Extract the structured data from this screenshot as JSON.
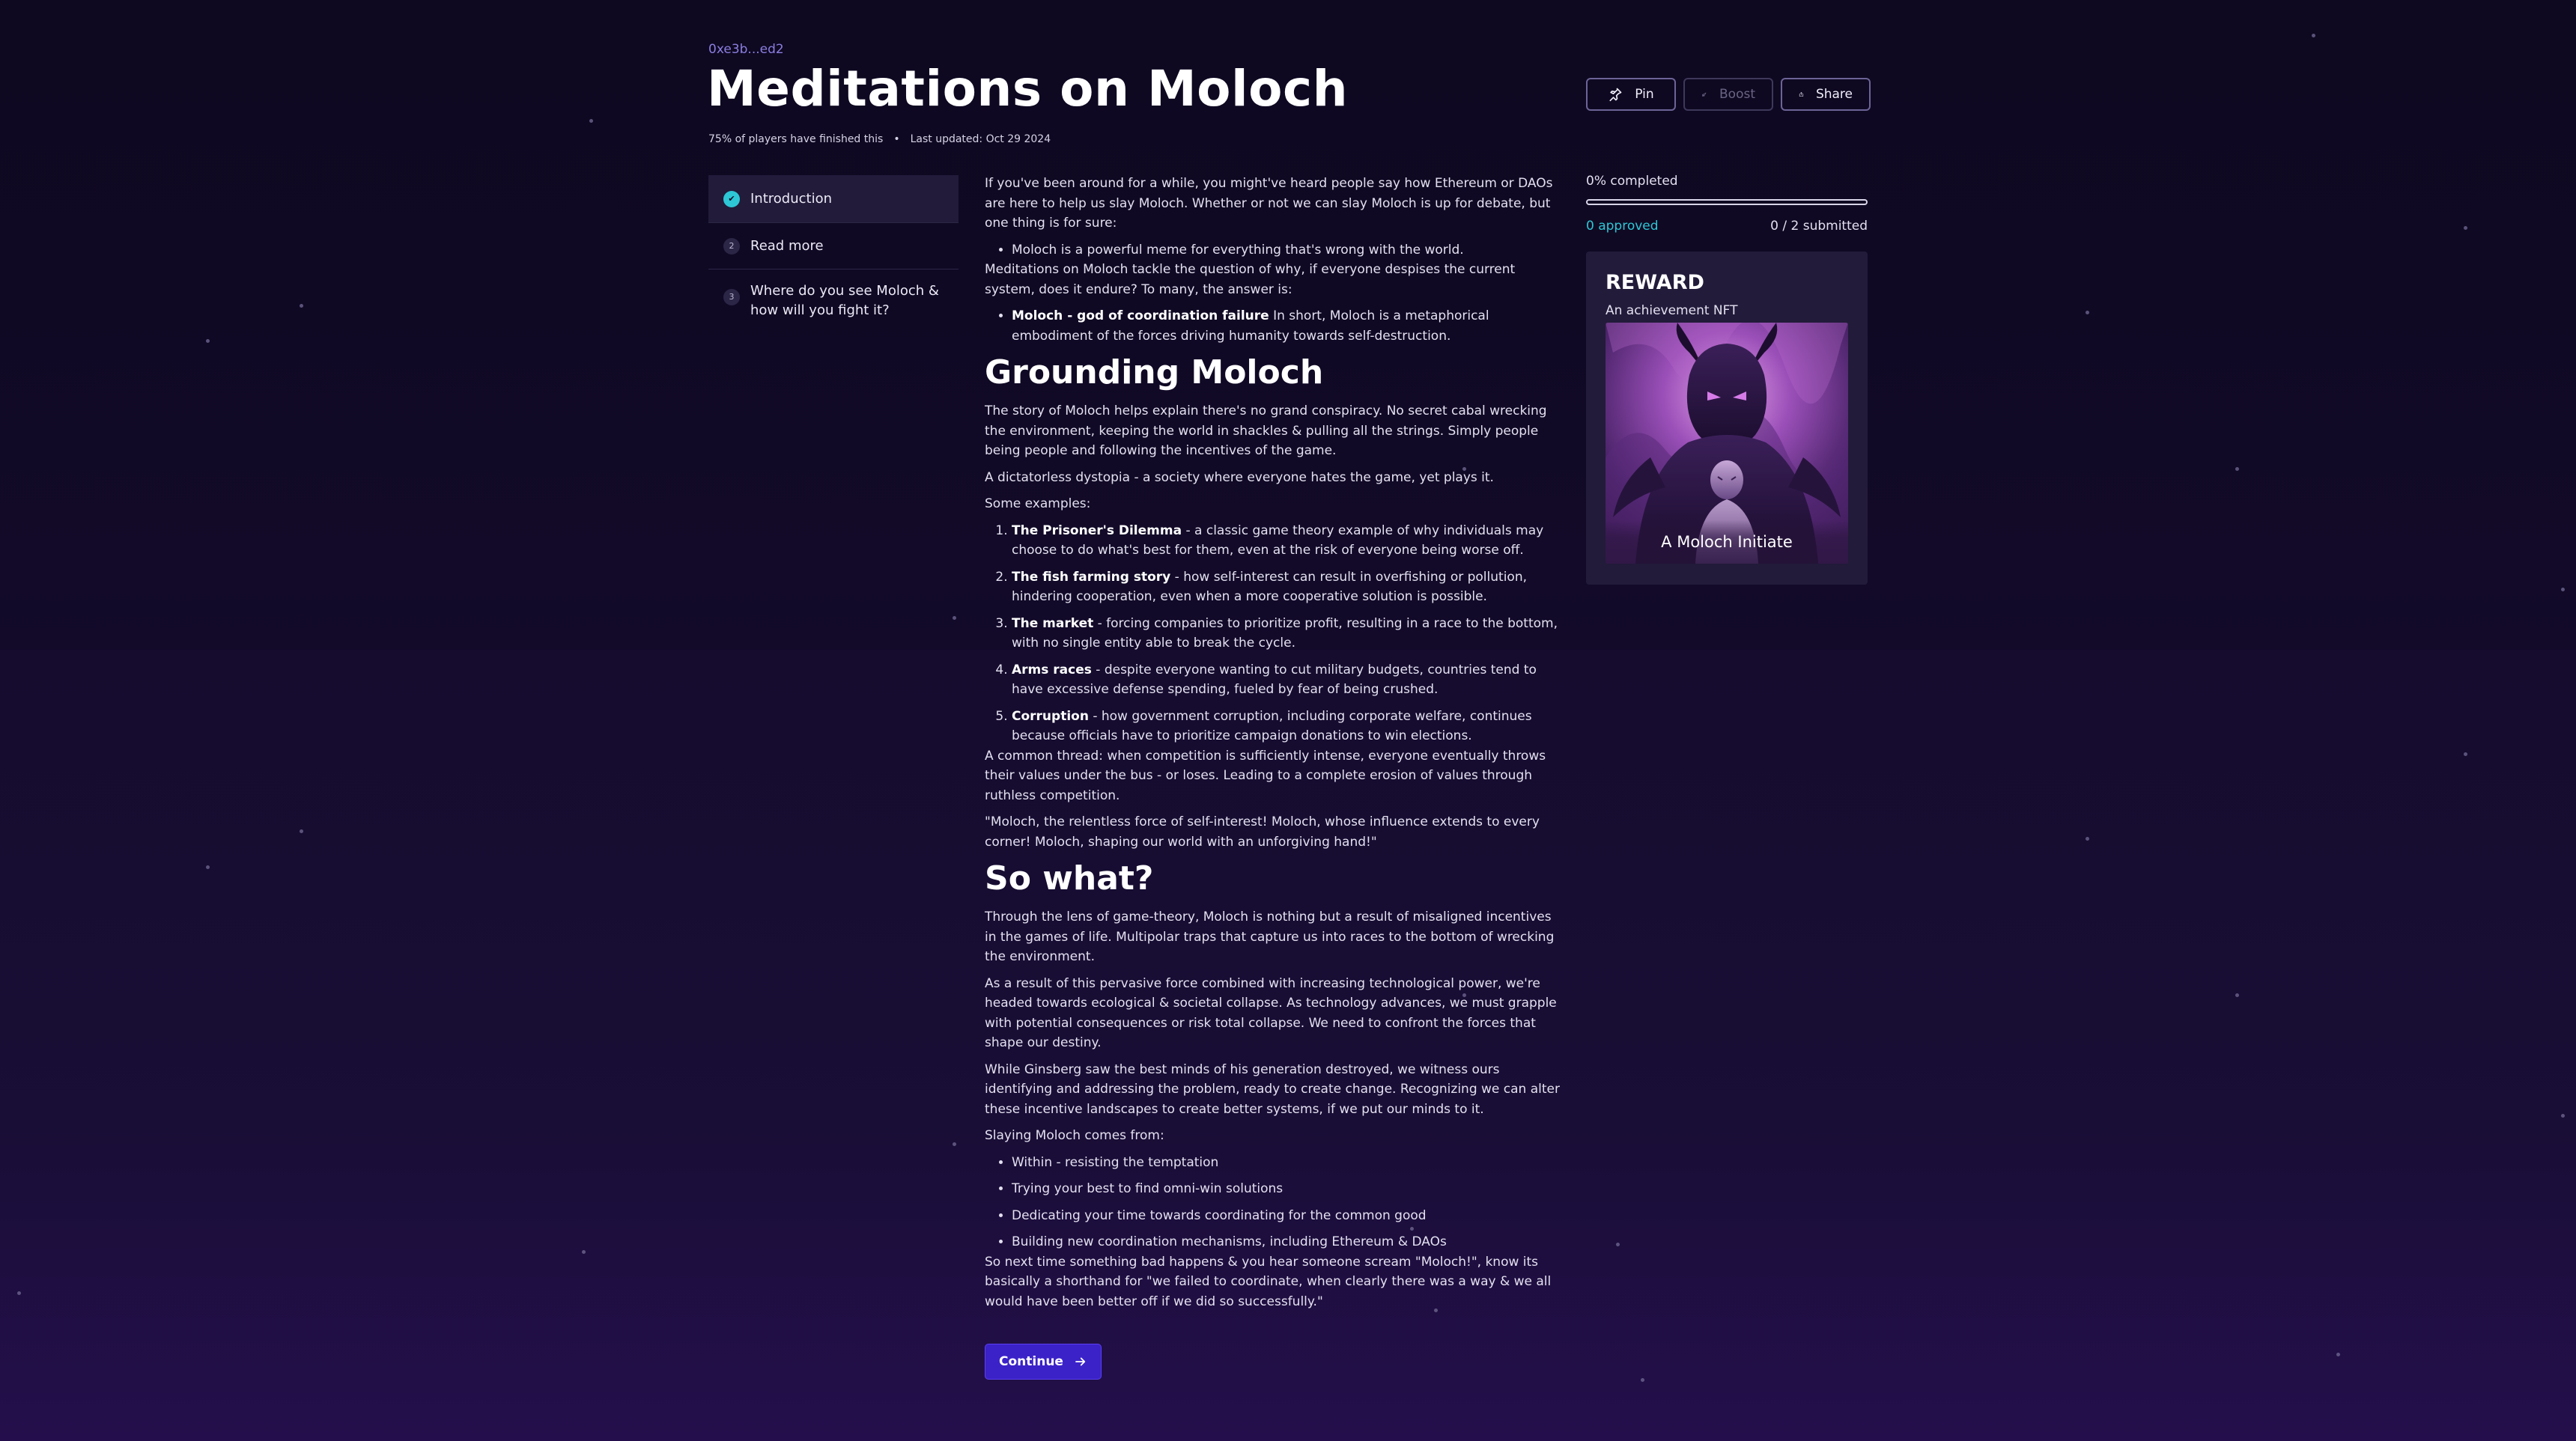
{
  "header": {
    "address": "0xe3b...ed2",
    "title": "Meditations on Moloch",
    "completion_stat": "75% of players have finished this",
    "separator": "•",
    "last_updated": "Last updated: Oct 29 2024"
  },
  "actions": {
    "pin_label": "Pin",
    "boost_label": "Boost",
    "share_label": "Share"
  },
  "toc": {
    "items": [
      {
        "number": "1",
        "label": "Introduction",
        "state": "done"
      },
      {
        "number": "2",
        "label": "Read more",
        "state": "pending"
      },
      {
        "number": "3",
        "label": "Where do you see Moloch & how will you fight it?",
        "state": "pending"
      }
    ]
  },
  "article": {
    "intro_p1": "If you've been around for a while, you might've heard people say how Ethereum or DAOs are here to help us slay Moloch. Whether or not we can slay Moloch is up for debate, but one thing is for sure:",
    "intro_bullet": "Moloch is a powerful meme for everything that's wrong with the world.",
    "intro_p2": "Meditations on Moloch tackle the question of why, if everyone despises the current system, does it endure? To many, the answer is:",
    "def_bold": "Moloch - god of coordination failure",
    "def_text": " In short, Moloch is a metaphorical embodiment of the forces driving humanity towards self-destruction.",
    "h_grounding": "Grounding Moloch",
    "grounding_p1": "The story of Moloch helps explain there's no grand conspiracy. No secret cabal wrecking the environment, keeping the world in shackles & pulling all the strings. Simply people being people and following the incentives of the game.",
    "grounding_p2": "A dictatorless dystopia - a society where everyone hates the game, yet plays it.",
    "examples_intro": "Some examples:",
    "examples": [
      {
        "bold": "The Prisoner's Dilemma",
        "text": " - a classic game theory example of why individuals may choose to do what's best for them, even at the risk of everyone being worse off."
      },
      {
        "bold": "The fish farming story",
        "text": " - how self-interest can result in overfishing or pollution, hindering cooperation, even when a more cooperative solution is possible."
      },
      {
        "bold": "The market",
        "text": " - forcing companies to prioritize profit, resulting in a race to the bottom, with no single entity able to break the cycle."
      },
      {
        "bold": "Arms races",
        "text": " - despite everyone wanting to cut military budgets, countries tend to have excessive defense spending, fueled by fear of being crushed."
      },
      {
        "bold": "Corruption",
        "text": " - how government corruption, including corporate welfare, continues because officials have to prioritize campaign donations to win elections."
      }
    ],
    "thread_p": "A common thread: when competition is sufficiently intense, everyone eventually throws their values under the bus - or loses. Leading to a complete erosion of values through ruthless competition.",
    "quote_p": "\"Moloch, the relentless force of self-interest! Moloch, whose influence extends to every corner! Moloch, shaping our world with an unforgiving hand!\"",
    "h_sowhat": "So what?",
    "sowhat_p1": "Through the lens of game-theory, Moloch is nothing but a result of misaligned incentives in the games of life. Multipolar traps that capture us into races to the bottom of wrecking the environment.",
    "sowhat_p2": "As a result of this pervasive force combined with increasing technological power, we're headed towards ecological & societal collapse. As technology advances, we must grapple with potential consequences or risk total collapse. We need to confront the forces that shape our destiny.",
    "sowhat_p3": "While Ginsberg saw the best minds of his generation destroyed, we witness ours identifying and addressing the problem, ready to create change. Recognizing we can alter these incentive landscapes to create better systems, if we put our minds to it.",
    "slaying_intro": "Slaying Moloch comes from:",
    "slaying": [
      "Within - resisting the temptation",
      "Trying your best to find omni-win solutions",
      "Dedicating your time towards coordinating for the common good",
      "Building new coordination mechanisms, including Ethereum & DAOs"
    ],
    "closing_p": "So next time something bad happens & you hear someone scream \"Moloch!\", know its basically a shorthand for \"we failed to coordinate, when clearly there was a way & we all would have been better off if we did so successfully.\"",
    "continue_label": "Continue"
  },
  "sidebar": {
    "progress_label": "0% completed",
    "progress_value": 0,
    "approved": "0 approved",
    "submitted": "0 / 2 submitted",
    "reward_title": "REWARD",
    "reward_subtitle": "An achievement NFT",
    "nft_caption": "A Moloch Initiate"
  },
  "colors": {
    "accent_cyan": "#2dc7d6",
    "button_purple": "#3b22c8",
    "link_purple": "#8a7ee0",
    "panel": "#221b3a"
  }
}
